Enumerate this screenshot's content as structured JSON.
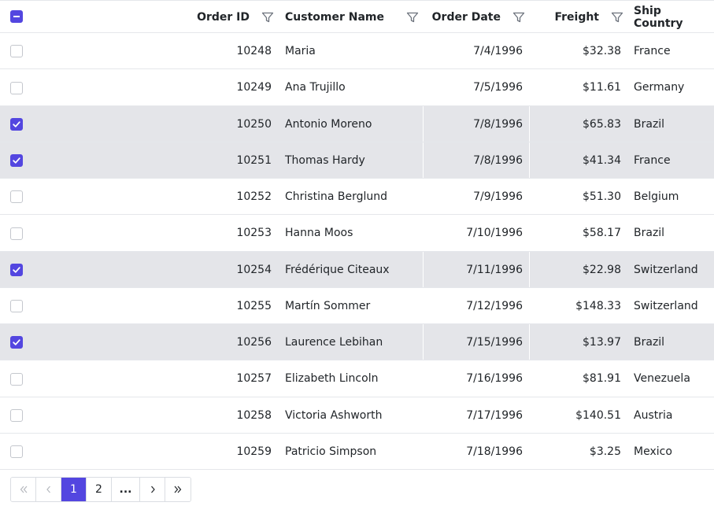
{
  "accent_color": "#5346e0",
  "header": {
    "select_all_state": "indeterminate",
    "columns": [
      {
        "label": "Order ID"
      },
      {
        "label": "Customer Name"
      },
      {
        "label": "Order Date"
      },
      {
        "label": "Freight"
      },
      {
        "label": "Ship Country"
      }
    ],
    "filter_icon": "filter-funnel-icon"
  },
  "rows": [
    {
      "selected": false,
      "order_id": "10248",
      "customer": "Maria",
      "date": "7/4/1996",
      "freight": "$32.38",
      "country": "France"
    },
    {
      "selected": false,
      "order_id": "10249",
      "customer": "Ana Trujillo",
      "date": "7/5/1996",
      "freight": "$11.61",
      "country": "Germany"
    },
    {
      "selected": true,
      "order_id": "10250",
      "customer": "Antonio Moreno",
      "date": "7/8/1996",
      "freight": "$65.83",
      "country": "Brazil"
    },
    {
      "selected": true,
      "order_id": "10251",
      "customer": "Thomas Hardy",
      "date": "7/8/1996",
      "freight": "$41.34",
      "country": "France"
    },
    {
      "selected": false,
      "order_id": "10252",
      "customer": "Christina Berglund",
      "date": "7/9/1996",
      "freight": "$51.30",
      "country": "Belgium"
    },
    {
      "selected": false,
      "order_id": "10253",
      "customer": "Hanna Moos",
      "date": "7/10/1996",
      "freight": "$58.17",
      "country": "Brazil"
    },
    {
      "selected": true,
      "order_id": "10254",
      "customer": "Frédérique Citeaux",
      "date": "7/11/1996",
      "freight": "$22.98",
      "country": "Switzerland"
    },
    {
      "selected": false,
      "order_id": "10255",
      "customer": "Martín Sommer",
      "date": "7/12/1996",
      "freight": "$148.33",
      "country": "Switzerland"
    },
    {
      "selected": true,
      "order_id": "10256",
      "customer": "Laurence Lebihan",
      "date": "7/15/1996",
      "freight": "$13.97",
      "country": "Brazil"
    },
    {
      "selected": false,
      "order_id": "10257",
      "customer": "Elizabeth Lincoln",
      "date": "7/16/1996",
      "freight": "$81.91",
      "country": "Venezuela"
    },
    {
      "selected": false,
      "order_id": "10258",
      "customer": "Victoria Ashworth",
      "date": "7/17/1996",
      "freight": "$140.51",
      "country": "Austria"
    },
    {
      "selected": false,
      "order_id": "10259",
      "customer": "Patricio Simpson",
      "date": "7/18/1996",
      "freight": "$3.25",
      "country": "Mexico"
    }
  ],
  "pager": {
    "first_icon": "double-chevron-left-icon",
    "prev_icon": "chevron-left-icon",
    "pages": [
      "1",
      "2"
    ],
    "current_page": "1",
    "ellipsis": "...",
    "next_icon": "chevron-right-icon",
    "last_icon": "double-chevron-right-icon"
  }
}
